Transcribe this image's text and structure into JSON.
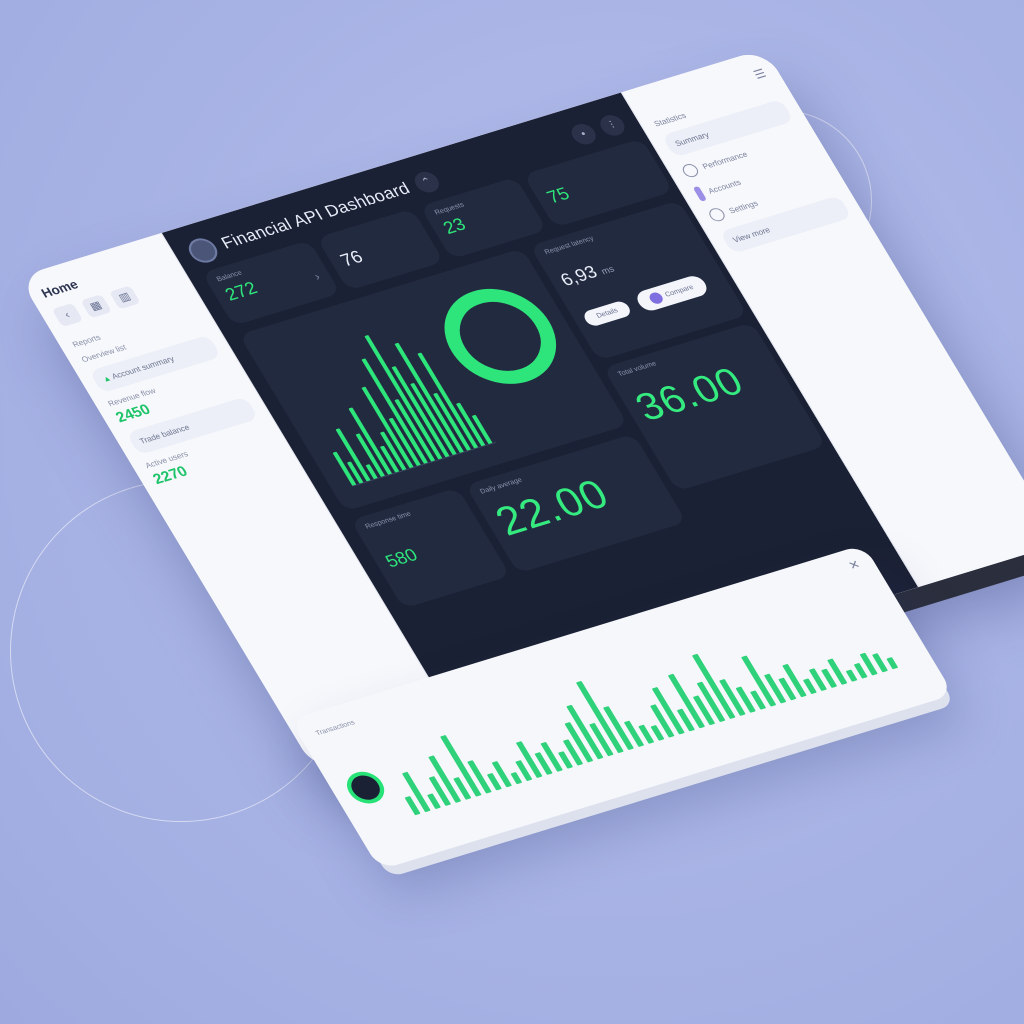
{
  "colors": {
    "accent": "#2ee57b",
    "dark_bg": "#1b2134",
    "card_bg": "#222a40",
    "panel_bg": "#f7f8fc"
  },
  "dashboard": {
    "title": "Financial API Dashboard",
    "header_icons": [
      "avatar",
      "share-icon",
      "settings-icon",
      "filter-icon"
    ]
  },
  "left_panel": {
    "title": "Home",
    "nav_icons": [
      "back-arrow-icon",
      "grid-icon",
      "chart-icon"
    ],
    "section_label": "Reports",
    "summary_label": "Overview list",
    "card_label": "Account summary",
    "metric_a_label": "Revenue flow",
    "metric_a_value": "2450",
    "card_b_label": "Trade balance",
    "metric_b_label": "Active users",
    "metric_b_value": "2270"
  },
  "right_panel": {
    "item_1": "Statistics",
    "card_1": "Summary",
    "item_2": "Performance",
    "item_3": "Accounts",
    "item_4": "Settings",
    "card_2": "View more"
  },
  "cards": {
    "kpi_a": {
      "label": "Balance",
      "value": "272"
    },
    "kpi_b": {
      "value": "76"
    },
    "kpi_c": {
      "label": "Requests",
      "value": "23"
    },
    "kpi_d": {
      "value": "75"
    },
    "stats": {
      "label": "Request latency",
      "value": "6,93",
      "unit": "ms",
      "pill_1": "Details",
      "pill_2": "Compare"
    },
    "big_1": {
      "label": "Total volume",
      "value": "36.00"
    },
    "big_2": {
      "label": "Daily average",
      "value": "22.00"
    },
    "small_1": {
      "label": "Response time",
      "value": "580"
    }
  },
  "strip": {
    "label": "Transactions"
  },
  "chart_data": [
    {
      "type": "bar",
      "title": "",
      "values": [
        14,
        9,
        22,
        6,
        18,
        28,
        11,
        16,
        34,
        20,
        44,
        26,
        52,
        38,
        30,
        46,
        24,
        40,
        18,
        12
      ]
    },
    {
      "type": "pie",
      "title": "",
      "values": [
        100
      ]
    },
    {
      "type": "bar",
      "title": "",
      "values": [
        10,
        22,
        8,
        16,
        26,
        12,
        34,
        18,
        9,
        14,
        6,
        11,
        20,
        12,
        16,
        9,
        14,
        22,
        30,
        18,
        40,
        24,
        14,
        10,
        8,
        18,
        26,
        12,
        30,
        16,
        22,
        36,
        20,
        14,
        10,
        28,
        16,
        12,
        18,
        8,
        12,
        10,
        14,
        6,
        8,
        12,
        10,
        6
      ]
    }
  ]
}
